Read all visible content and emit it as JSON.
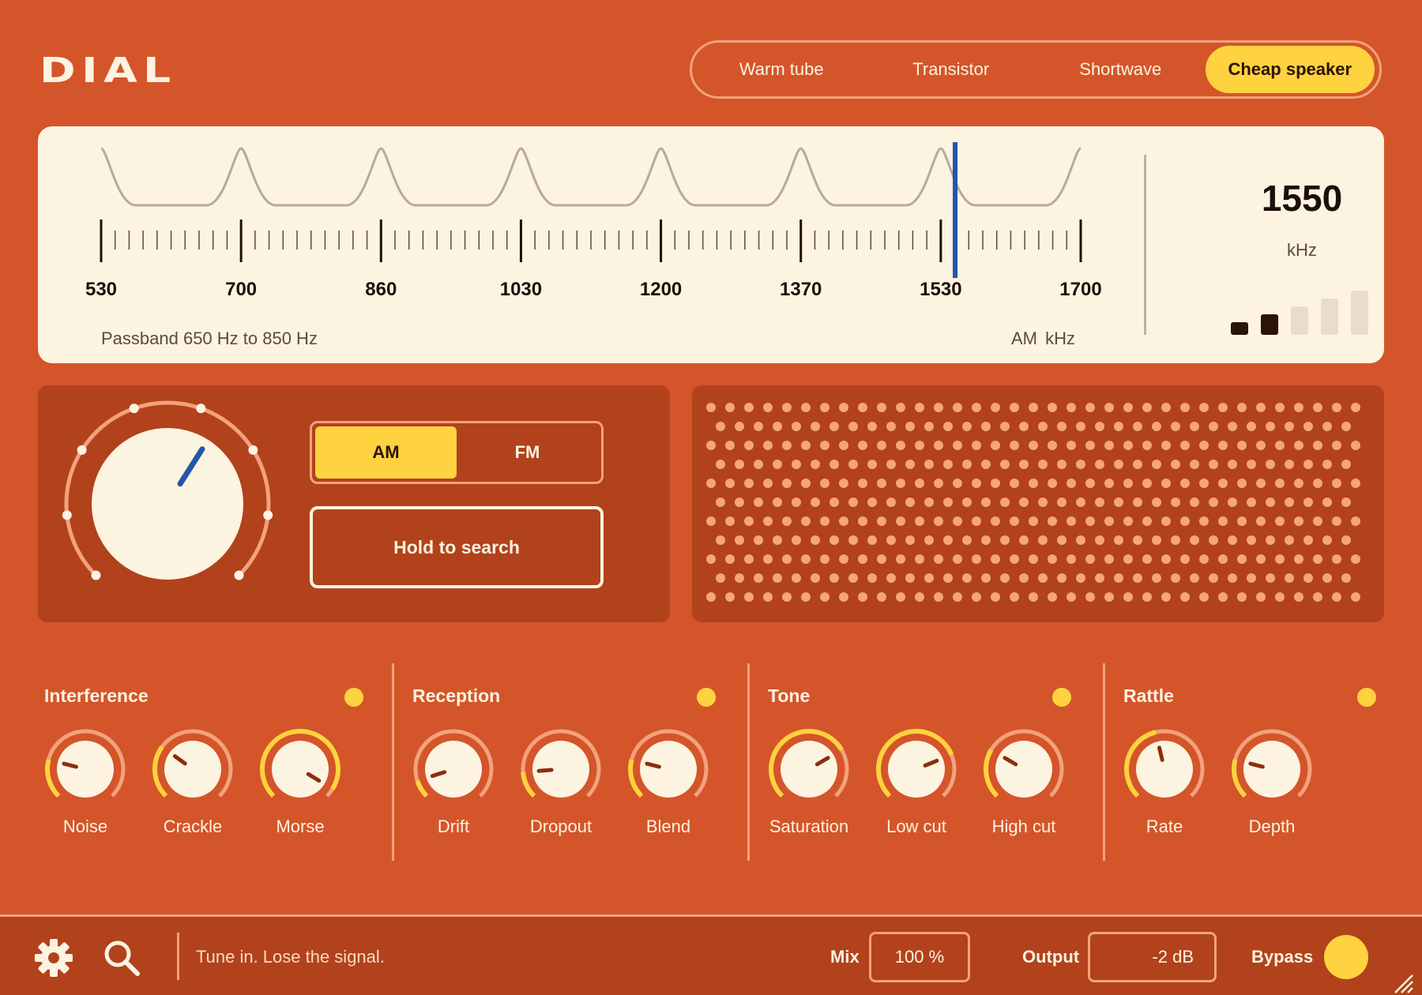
{
  "app": {
    "logo": "DIAL"
  },
  "presets": [
    {
      "label": "Warm tube",
      "active": false
    },
    {
      "label": "Transistor",
      "active": false
    },
    {
      "label": "Shortwave",
      "active": false
    },
    {
      "label": "Cheap speaker",
      "active": true
    }
  ],
  "tuner": {
    "scale_min": 530,
    "scale_max": 1700,
    "scale_labels": [
      "530",
      "700",
      "860",
      "1030",
      "1200",
      "1370",
      "1530",
      "1700"
    ],
    "needle_value": 1550,
    "passband": "Passband 650 Hz to 850 Hz",
    "units": "AM  kHz",
    "readout": {
      "value": "1550",
      "unit": "kHz"
    },
    "signal_strength": {
      "bars_total": 5,
      "bars_lit": 2
    }
  },
  "tune": {
    "dial_position_fraction": 0.62,
    "bands": [
      {
        "label": "AM",
        "active": true
      },
      {
        "label": "FM",
        "active": false
      }
    ],
    "hold_button": "Hold to search"
  },
  "groups": [
    {
      "title": "Interference",
      "enabled": true,
      "knobs": [
        {
          "label": "Noise",
          "value": 0.22
        },
        {
          "label": "Crackle",
          "value": 0.3
        },
        {
          "label": "Morse",
          "value": 0.95
        }
      ]
    },
    {
      "title": "Reception",
      "enabled": true,
      "knobs": [
        {
          "label": "Drift",
          "value": 0.1
        },
        {
          "label": "Dropout",
          "value": 0.15
        },
        {
          "label": "Blend",
          "value": 0.22
        }
      ]
    },
    {
      "title": "Tone",
      "enabled": true,
      "knobs": [
        {
          "label": "Saturation",
          "value": 0.72
        },
        {
          "label": "Low cut",
          "value": 0.75
        },
        {
          "label": "High cut",
          "value": 0.28
        }
      ]
    },
    {
      "title": "Rattle",
      "enabled": true,
      "knobs": [
        {
          "label": "Rate",
          "value": 0.45
        },
        {
          "label": "Depth",
          "value": 0.22
        }
      ]
    }
  ],
  "footer": {
    "tagline": "Tune in. Lose the signal.",
    "mix_label": "Mix",
    "mix_value": "100 %",
    "output_label": "Output",
    "output_value": "-2 dB",
    "bypass_label": "Bypass"
  },
  "colors": {
    "background": "#D4552A",
    "panel": "#B1421C",
    "cream": "#FDF3E1",
    "accent": "#FFD23F",
    "arc": "#F3A27C",
    "needle": "#2455A8"
  },
  "icons": {
    "settings": "gear-icon",
    "search": "search-icon",
    "resize": "resize-grip-icon"
  }
}
